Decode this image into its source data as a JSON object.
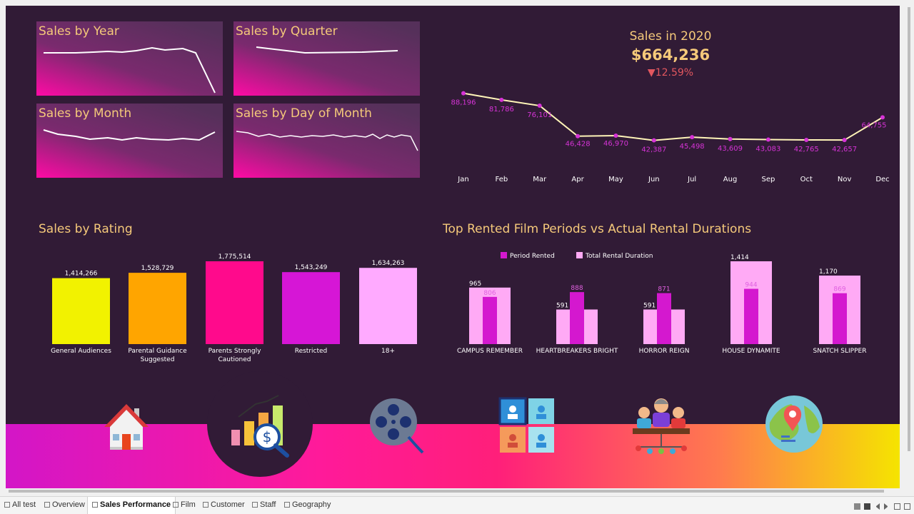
{
  "tabs": [
    {
      "label": "All test",
      "active": false
    },
    {
      "label": "Overview",
      "active": false
    },
    {
      "label": "Sales Performance",
      "active": true
    },
    {
      "label": "Film",
      "active": false
    },
    {
      "label": "Customer",
      "active": false
    },
    {
      "label": "Staff",
      "active": false
    },
    {
      "label": "Geography",
      "active": false
    }
  ],
  "sparklines": {
    "year": {
      "title": "Sales by Year"
    },
    "quarter": {
      "title": "Sales by Quarter"
    },
    "month": {
      "title": "Sales by Month"
    },
    "day": {
      "title": "Sales by Day of Month"
    }
  },
  "kpi": {
    "title": "Sales in 2020",
    "value": "$664,236",
    "change": "▼12.59%"
  },
  "sections": {
    "rating_title": "Sales by Rating",
    "rental_title": "Top Rented Film Periods vs Actual Rental Durations"
  },
  "colors": {
    "background": "#311b36",
    "accent_text": "#f5c97a",
    "decrease": "#e2575f"
  },
  "nav_icons": [
    {
      "name": "home-icon"
    },
    {
      "name": "sales-analytics-icon"
    },
    {
      "name": "film-reel-icon"
    },
    {
      "name": "customer-id-icon"
    },
    {
      "name": "staff-team-icon"
    },
    {
      "name": "globe-location-icon"
    }
  ],
  "chart_data": [
    {
      "type": "line",
      "categories": [
        "Jan",
        "Feb",
        "Mar",
        "Apr",
        "May",
        "Jun",
        "Jul",
        "Aug",
        "Sep",
        "Oct",
        "Nov",
        "Dec"
      ],
      "values": [
        88196,
        81786,
        76101,
        46428,
        46970,
        42387,
        45498,
        43609,
        43083,
        42765,
        42657,
        64755
      ],
      "labels": [
        "88,196",
        "81,786",
        "76,101",
        "46,428",
        "46,970",
        "42,387",
        "45,498",
        "43,609",
        "43,083",
        "42,765",
        "42,657",
        "64,755"
      ],
      "title": "Sales in 2020",
      "grid": false
    },
    {
      "type": "bar",
      "title": "Sales by Rating",
      "categories": [
        "General Audiences",
        "Parental Guidance Suggested",
        "Parents Strongly Cautioned",
        "Restricted",
        "18+"
      ],
      "category_lines": [
        [
          "General Audiences"
        ],
        [
          "Parental Guidance",
          "Suggested"
        ],
        [
          "Parents Strongly",
          "Cautioned"
        ],
        [
          "Restricted"
        ],
        [
          "18+"
        ]
      ],
      "values": [
        1414266,
        1528729,
        1775514,
        1543249,
        1634263
      ],
      "labels": [
        "1,414,266",
        "1,528,729",
        "1,775,514",
        "1,543,249",
        "1,634,263"
      ],
      "colors": [
        "#f2f200",
        "#ffa500",
        "#ff0a8c",
        "#d616d6",
        "#ffaaff"
      ],
      "ylim": [
        0,
        1775514
      ]
    },
    {
      "type": "bar",
      "title": "Top Rented Film Periods vs Actual Rental Durations",
      "categories": [
        "CAMPUS REMEMBER",
        "HEARTBREAKERS BRIGHT",
        "HORROR REIGN",
        "HOUSE DYNAMITE",
        "SNATCH SLIPPER"
      ],
      "series": [
        {
          "name": "Period Rented",
          "values": [
            806,
            888,
            871,
            944,
            869
          ],
          "labels": [
            "806",
            "888",
            "871",
            "944",
            "869"
          ],
          "color": "#d418cf"
        },
        {
          "name": "Total Rental Duration",
          "values": [
            965,
            591,
            591,
            1414,
            1170
          ],
          "labels": [
            "965",
            "591",
            "591",
            "1,414",
            "1,170"
          ],
          "color": "#ffaaf5"
        }
      ],
      "legend": "top-left",
      "ylim": [
        0,
        1414
      ]
    }
  ]
}
